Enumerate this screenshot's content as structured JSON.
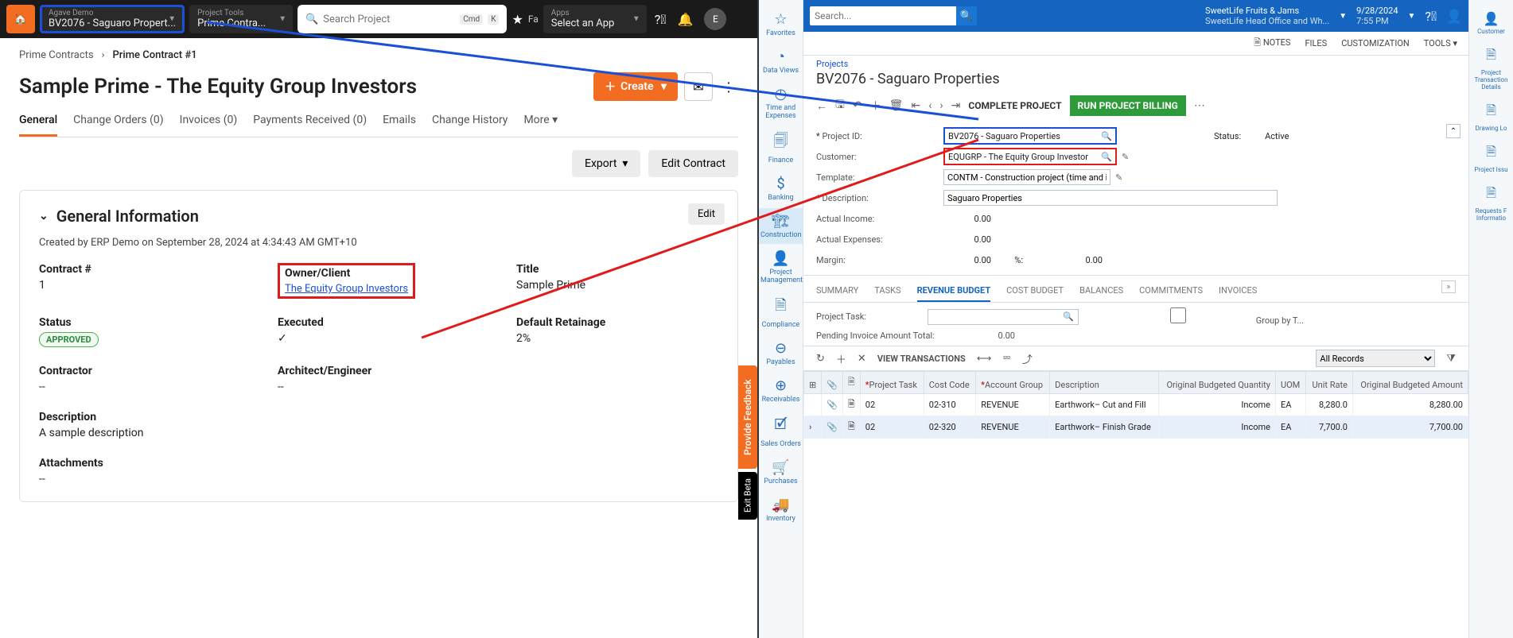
{
  "left": {
    "nav1": {
      "small": "Agave Demo",
      "large": "BV2076 - Saguaro Propert..."
    },
    "nav2": {
      "small": "Project Tools",
      "large": "Prime Contra..."
    },
    "search_placeholder": "Search Project",
    "kbd1": "Cmd",
    "kbd2": "K",
    "fav": "Fa",
    "apps": {
      "small": "Apps",
      "large": "Select an App"
    },
    "avatar": "E",
    "breadcrumb": {
      "a": "Prime Contracts",
      "b": "Prime Contract #1"
    },
    "title": "Sample Prime - The Equity Group Investors",
    "create": "Create",
    "tabs": [
      "General",
      "Change Orders (0)",
      "Invoices (0)",
      "Payments Received (0)",
      "Emails",
      "Change History",
      "More"
    ],
    "export": "Export",
    "edit_contract": "Edit Contract",
    "section": "General Information",
    "edit": "Edit",
    "created": "Created by ERP Demo on September 28, 2024 at 4:34:43 AM GMT+10",
    "fields": {
      "contract_no": {
        "label": "Contract #",
        "value": "1"
      },
      "owner": {
        "label": "Owner/Client",
        "value": "The Equity Group Investors"
      },
      "title": {
        "label": "Title",
        "value": "Sample Prime"
      },
      "status": {
        "label": "Status",
        "value": "APPROVED"
      },
      "executed": {
        "label": "Executed",
        "value": "✓"
      },
      "retainage": {
        "label": "Default Retainage",
        "value": "2%"
      },
      "contractor": {
        "label": "Contractor",
        "value": "--"
      },
      "architect": {
        "label": "Architect/Engineer",
        "value": "--"
      },
      "description": {
        "label": "Description",
        "value": "A sample description"
      },
      "attachments": {
        "label": "Attachments",
        "value": "--"
      }
    },
    "feedback": "Provide Feedback",
    "exitbeta": "Exit Beta"
  },
  "right": {
    "search_placeholder": "Search...",
    "biz": {
      "name": "SweetLife Fruits & Jams",
      "loc": "SweetLife Head Office and Wh...",
      "date": "9/28/2024",
      "time": "7:55 PM"
    },
    "toolbar": [
      "NOTES",
      "FILES",
      "CUSTOMIZATION",
      "TOOLS ▾"
    ],
    "crumb": "Projects",
    "title": "BV2076 - Saguaro Properties",
    "complete": "COMPLETE PROJECT",
    "runbill": "RUN PROJECT BILLING",
    "form": {
      "project_id": {
        "label": "Project ID:",
        "value": "BV2076 - Saguaro Properties"
      },
      "customer": {
        "label": "Customer:",
        "value": "EQUGRP - The Equity Group Investor"
      },
      "template": {
        "label": "Template:",
        "value": "CONTM - Construction project (time and i"
      },
      "description": {
        "label": "Description:",
        "value": "Saguaro Properties"
      },
      "actual_income": {
        "label": "Actual Income:",
        "value": "0.00"
      },
      "actual_expenses": {
        "label": "Actual Expenses:",
        "value": "0.00"
      },
      "margin": {
        "label": "Margin:",
        "value": "0.00",
        "pct_label": "%:",
        "pct_value": "0.00"
      },
      "status": {
        "label": "Status:",
        "value": "Active"
      }
    },
    "tabs": [
      "SUMMARY",
      "TASKS",
      "REVENUE BUDGET",
      "COST BUDGET",
      "BALANCES",
      "COMMITMENTS",
      "INVOICES"
    ],
    "filter": {
      "task_label": "Project Task:",
      "group_label": "Group by T...",
      "pending_label": "Pending Invoice Amount Total:",
      "pending_value": "0.00"
    },
    "gridbar": {
      "viewtrans": "VIEW TRANSACTIONS",
      "allrecords": "All Records"
    },
    "cols": [
      "Project Task",
      "Cost Code",
      "Account Group",
      "Description",
      "Original Budgeted Quantity",
      "UOM",
      "Unit Rate",
      "Original Budgeted Amount"
    ],
    "rows": [
      {
        "task": "02",
        "cost": "02-310",
        "acct": "REVENUE",
        "desc": "Earthwork– Cut and Fill",
        "qty": "Income",
        "uom": "EA",
        "rate": "8,280.0",
        "amt": "8,280.00"
      },
      {
        "task": "02",
        "cost": "02-320",
        "acct": "REVENUE",
        "desc": "Earthwork– Finish Grade",
        "qty": "Income",
        "uom": "EA",
        "rate": "7,700.0",
        "amt": "7,700.00"
      }
    ],
    "leftnav": [
      "Favorites",
      "Data Views",
      "Time and Expenses",
      "Finance",
      "Banking",
      "Construction",
      "Project Management",
      "Compliance",
      "Payables",
      "Receivables",
      "Sales Orders",
      "Purchases",
      "Inventory"
    ],
    "rightnav": [
      "Customer",
      "Project Transaction Details",
      "Drawing Lo",
      "Project Issu",
      "Requests F Informatio"
    ]
  }
}
